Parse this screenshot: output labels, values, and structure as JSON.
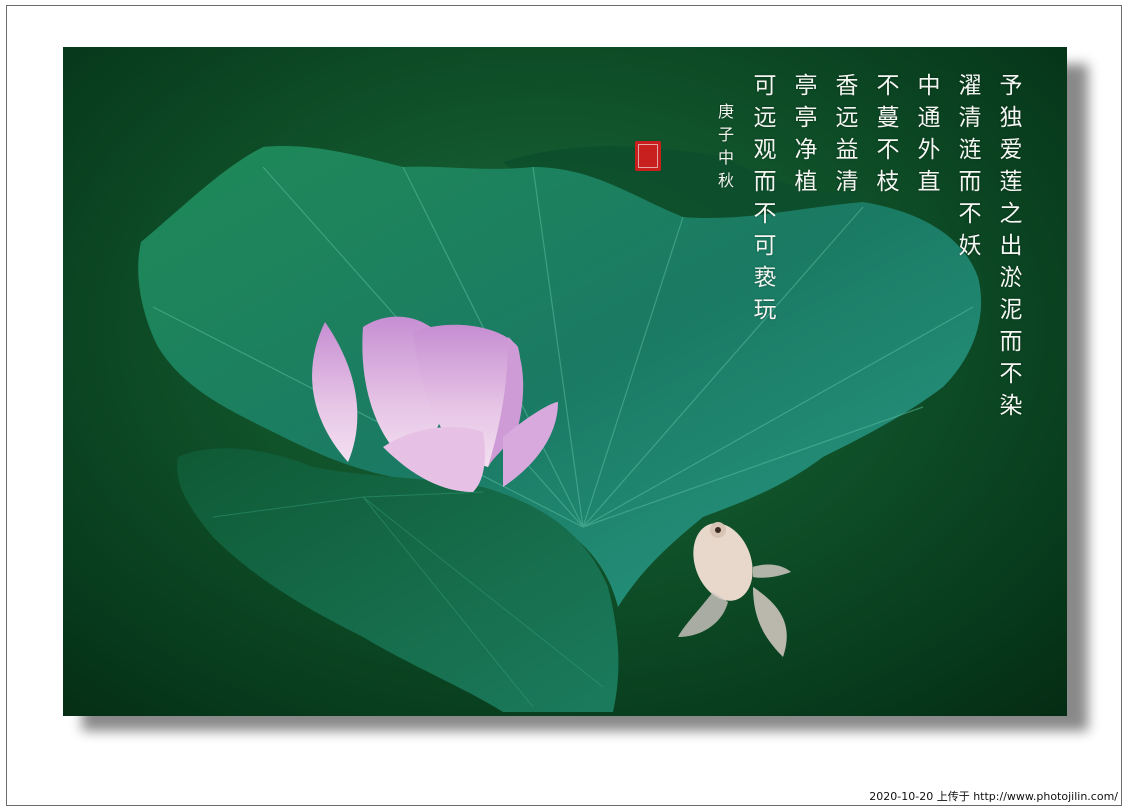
{
  "poem": {
    "columns": [
      "予独爱莲之出淤泥而不染",
      "濯清涟而不妖",
      "中通外直",
      "不蔓不枝",
      "香远益清",
      "亭亭净植",
      "可远观而不可亵玩"
    ],
    "signature": "庚子中秋"
  },
  "footer": {
    "text": "2020-10-20 上传于 http://www.photojilin.com/"
  },
  "colors": {
    "background": "#0f5029",
    "leaf": "#1e7a55",
    "petal": "#d7a6d8",
    "seal": "#c7201e"
  },
  "icons": [
    "lotus-flower-icon",
    "lotus-leaf-icon",
    "goldfish-icon",
    "seal-stamp-icon"
  ]
}
